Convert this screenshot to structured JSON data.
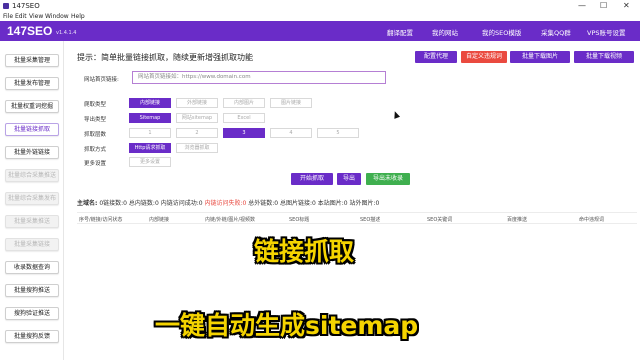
{
  "window": {
    "title": "147SEO",
    "controls": {
      "minimize": "—",
      "maximize": "☐",
      "close": "✕"
    }
  },
  "menu": [
    "File",
    "Edit",
    "View",
    "Window",
    "Help"
  ],
  "header": {
    "logo": "147SEO",
    "version": "v1.4.1.4",
    "nav": [
      "翻译配置",
      "我的网站",
      "我的SEO模版",
      "采集QQ群",
      "VPS账号设置"
    ]
  },
  "sidebar": {
    "items": [
      {
        "label": "批量采集管理",
        "state": "normal"
      },
      {
        "label": "批量发布管理",
        "state": "normal"
      },
      {
        "label": "批量权重词挖掘",
        "state": "normal"
      },
      {
        "label": "批量链接抓取",
        "state": "active"
      },
      {
        "label": "批量外链链接",
        "state": "normal"
      },
      {
        "label": "批量综合采集推送",
        "state": "disabled"
      },
      {
        "label": "批量综合采集发布",
        "state": "disabled"
      },
      {
        "label": "批量采集推送",
        "state": "disabled"
      },
      {
        "label": "批量采集链接",
        "state": "disabled"
      },
      {
        "label": "收录数据查询",
        "state": "normal"
      },
      {
        "label": "批量搜狗推送",
        "state": "normal"
      },
      {
        "label": "搜狗验证推送",
        "state": "normal"
      },
      {
        "label": "批量搜狗反馈",
        "state": "normal"
      }
    ]
  },
  "main": {
    "hint": "提示：简单批量链接抓取，随续更新增强抓取功能",
    "top_buttons": [
      {
        "label": "配置代理",
        "color": "#6a2cc8"
      },
      {
        "label": "自定义违规词",
        "color": "#ea4a3f"
      },
      {
        "label": "批量下载图片",
        "color": "#6a2cc8"
      },
      {
        "label": "批量下载视频",
        "color": "#6a2cc8"
      }
    ],
    "url_label": "网站首页链接:",
    "url_placeholder": "网站首页链接如：https://www.domain.com",
    "rows": {
      "crawl_type": {
        "label": "爬取类型",
        "options": [
          "内部链接",
          "外部链接",
          "内部图片",
          "图片链接"
        ],
        "selected": 0
      },
      "export_type": {
        "label": "导出类型",
        "options": [
          "Sitemap",
          "网站sitemap",
          "Excel"
        ],
        "selected": 0
      },
      "depth": {
        "label": "抓取层数",
        "options": [
          "1",
          "2",
          "3",
          "4",
          "5"
        ],
        "selected": 2
      },
      "method": {
        "label": "抓取方式",
        "options": [
          "Http请求抓取",
          "浏览器抓取"
        ],
        "selected": 0
      },
      "more": {
        "label": "更多设置",
        "options": [
          "更多设置"
        ]
      }
    },
    "actions": [
      {
        "label": "开始抓取",
        "color": "#6a2cc8"
      },
      {
        "label": "导出",
        "color": "#6a2cc8"
      },
      {
        "label": "导出未收录",
        "color": "#3faf4f"
      }
    ],
    "stats": {
      "title": "主域名:",
      "items": [
        {
          "text": "0链接数:0",
          "red": false
        },
        {
          "text": "总内链数:0",
          "red": false
        },
        {
          "text": "内链访问成功:0",
          "red": false
        },
        {
          "text": "内链访问失败:0",
          "red": true
        },
        {
          "text": "总外链数:0",
          "red": false
        },
        {
          "text": "总图片链接:0",
          "red": false
        },
        {
          "text": "本站图片:0",
          "red": false
        },
        {
          "text": "站外图片:0",
          "red": false
        }
      ]
    },
    "table_headers": [
      "序号/链接/访问状态",
      "内部链接",
      "内链/外链/图片/视频数",
      "SEO标题",
      "SEO描述",
      "SEO关键词",
      "百度推送",
      "命中违规词"
    ]
  },
  "captions": {
    "line1": "链接抓取",
    "line2": "一键自动生成sitemap"
  }
}
